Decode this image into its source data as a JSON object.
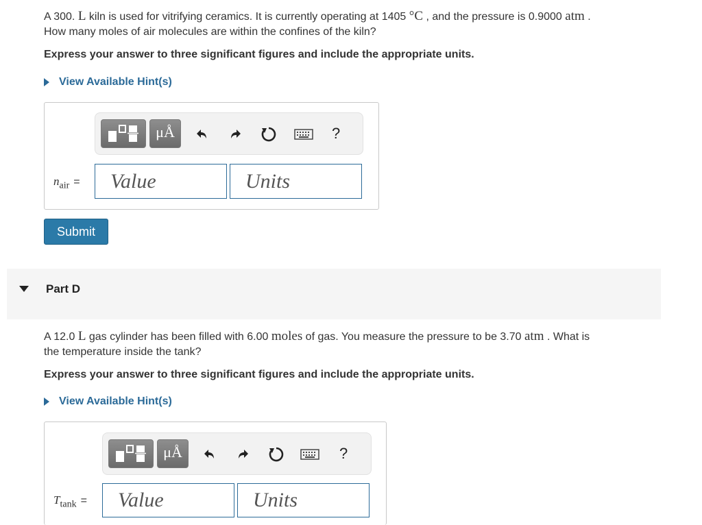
{
  "part_c": {
    "question_line1_a": "A 300. ",
    "question_unit_L": "L",
    "question_line1_b": " kiln is used for vitrifying ceramics. It is currently operating at 1405 ",
    "question_unit_C": "°C",
    "question_line1_c": " , and the pressure is 0.9000 ",
    "question_unit_atm": "atm",
    "question_line1_d": " .",
    "question_line2": "How many moles of air molecules are within the confines of the kiln?",
    "instruction": "Express your answer to three significant figures and include the appropriate units.",
    "hint_label": "View Available Hint(s)",
    "variable": "n",
    "variable_sub": "air",
    "equals": "=",
    "value_placeholder": "Value",
    "units_placeholder": "Units",
    "submit_label": "Submit"
  },
  "part_d": {
    "title": "Part D",
    "question_line1_a": "A 12.0 ",
    "question_unit_L": "L",
    "question_line1_b": " gas cylinder has been filled with 6.00 ",
    "question_unit_moles": "moles",
    "question_line1_c": " of gas. You measure the pressure to be 3.70 ",
    "question_unit_atm": "atm",
    "question_line1_d": " . What is",
    "question_line2": "the temperature inside the tank?",
    "instruction": "Express your answer to three significant figures and include the appropriate units.",
    "hint_label": "View Available Hint(s)",
    "variable": "T",
    "variable_sub": "tank",
    "equals": "=",
    "value_placeholder": "Value",
    "units_placeholder": "Units"
  },
  "toolbar": {
    "units_symbol": "μÅ",
    "help": "?"
  },
  "icons": [
    "templates-icon",
    "units-icon",
    "undo-icon",
    "redo-icon",
    "reset-icon",
    "keyboard-icon",
    "help-icon"
  ]
}
